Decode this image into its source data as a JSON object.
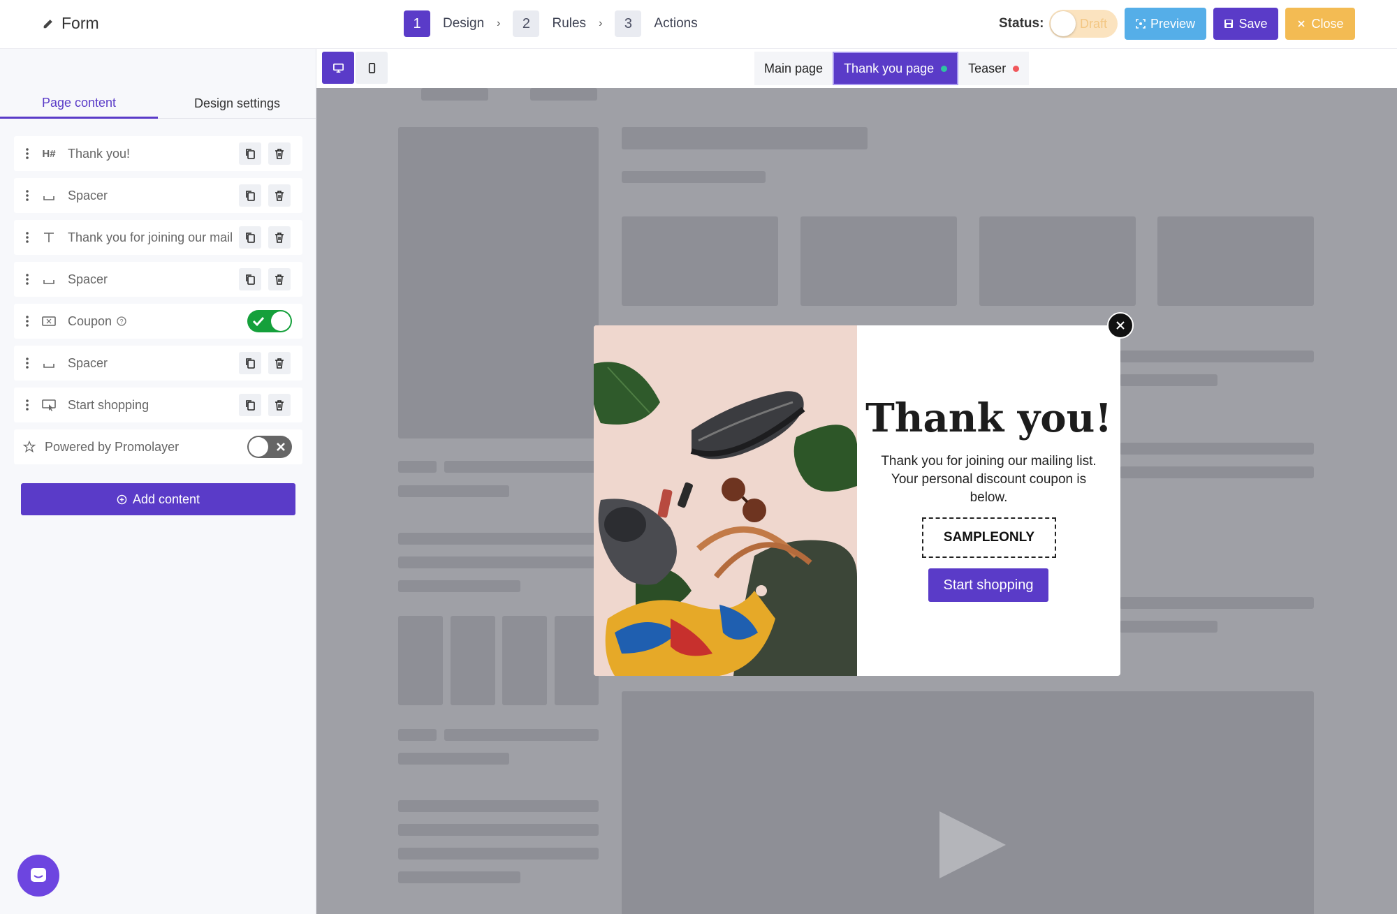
{
  "header": {
    "form_title": "Form",
    "steps": [
      {
        "num": "1",
        "label": "Design"
      },
      {
        "num": "2",
        "label": "Rules"
      },
      {
        "num": "3",
        "label": "Actions"
      }
    ],
    "status_label": "Status:",
    "status_value": "Draft",
    "preview_label": "Preview",
    "save_label": "Save",
    "close_label": "Close"
  },
  "sidebar": {
    "tabs": [
      "Page content",
      "Design settings"
    ],
    "items": [
      {
        "icon": "heading-icon",
        "label": "Thank you!"
      },
      {
        "icon": "spacer-icon",
        "label": "Spacer"
      },
      {
        "icon": "text-icon",
        "label": "Thank you for joining our mail"
      },
      {
        "icon": "spacer-icon",
        "label": "Spacer"
      },
      {
        "icon": "coupon-icon",
        "label": "Coupon",
        "toggle": "on"
      },
      {
        "icon": "spacer-icon",
        "label": "Spacer"
      },
      {
        "icon": "button-icon",
        "label": "Start shopping"
      }
    ],
    "powered_label": "Powered by Promolayer",
    "powered_toggle": "off",
    "add_content_label": "Add content"
  },
  "canvas": {
    "page_tabs": [
      {
        "label": "Main page",
        "dot": ""
      },
      {
        "label": "Thank you page",
        "dot": "#2ec4a1"
      },
      {
        "label": "Teaser",
        "dot": "#f0575b"
      }
    ]
  },
  "popup": {
    "title": "Thank you!",
    "text": "Thank you for joining our mailing list. Your personal discount coupon is below.",
    "coupon_code": "SAMPLEONLY",
    "button_label": "Start shopping"
  },
  "colors": {
    "accent": "#5a3bc8",
    "preview": "#55aee8",
    "close": "#f3bb53",
    "toggle_on": "#15a03b"
  }
}
